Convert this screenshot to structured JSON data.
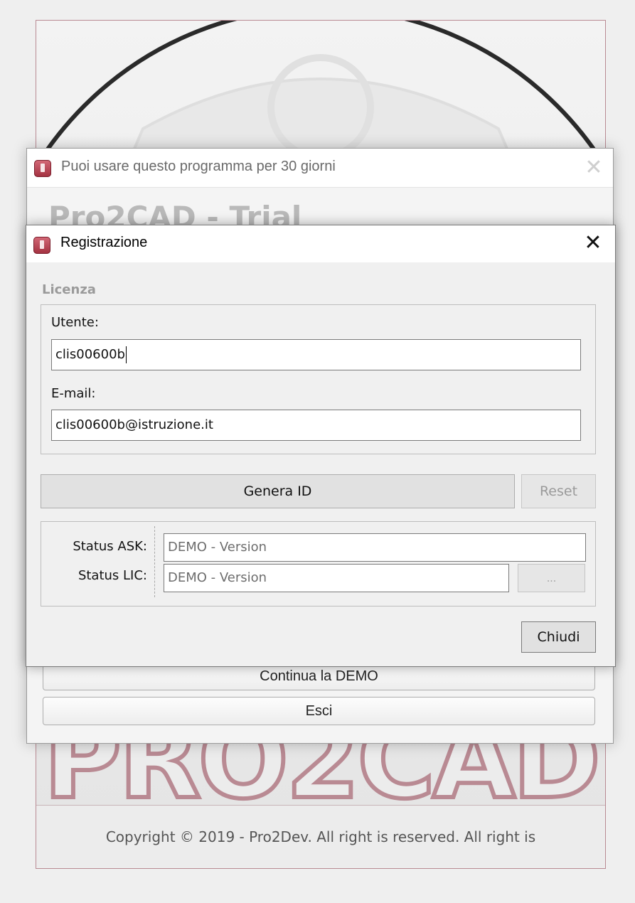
{
  "splash": {
    "logo_text": "PRO2CAD",
    "copyright": "Copyright © 2019 - Pro2Dev. All right is reserved. All right is"
  },
  "trial_window": {
    "title": "Puoi usare questo programma per 30 giorni",
    "heading": "Pro2CAD - Trial",
    "continue_label": "Continua la DEMO",
    "exit_label": "Esci",
    "icon": "app-icon"
  },
  "registration": {
    "title": "Registrazione",
    "close_glyph": "✕",
    "license_heading": "Licenza",
    "user_label": "Utente:",
    "user_value": "clis00600b",
    "email_label": "E-mail:",
    "email_value": "clis00600b@istruzione.it",
    "generate_id_label": "Genera ID",
    "reset_label": "Reset",
    "status_ask_label": "Status ASK:",
    "status_ask_value": "DEMO - Version",
    "status_lic_label": "Status LIC:",
    "status_lic_value": "DEMO - Version",
    "browse_label": "...",
    "close_label": "Chiudi"
  },
  "colors": {
    "brand": "#a2303f",
    "logo_outline": "#b98a93",
    "dark_band": "#7a1a22"
  }
}
